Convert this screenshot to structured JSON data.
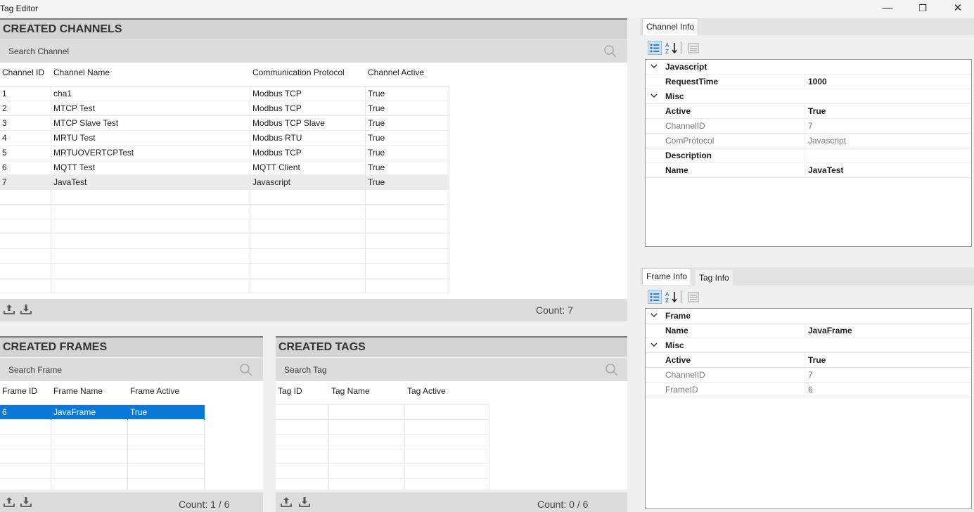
{
  "window": {
    "title": "Tag Editor",
    "minimize": "—",
    "restore": "❐",
    "close": "✕"
  },
  "channels": {
    "title": "CREATED CHANNELS",
    "search_placeholder": "Search Channel",
    "headers": [
      "Channel ID",
      "Channel Name",
      "Communication Protocol",
      "Channel Active"
    ],
    "rows": [
      [
        "1",
        "cha1",
        "Modbus TCP",
        "True"
      ],
      [
        "2",
        "MTCP Test",
        "Modbus TCP",
        "True"
      ],
      [
        "3",
        "MTCP Slave Test",
        "Modbus TCP Slave",
        "True"
      ],
      [
        "4",
        "MRTU Test",
        "Modbus RTU",
        "True"
      ],
      [
        "5",
        "MRTUOVERTCPTest",
        "Modbus TCP",
        "True"
      ],
      [
        "6",
        "MQTT Test",
        "MQTT Client",
        "True"
      ],
      [
        "7",
        "JavaTest",
        "Javascript",
        "True"
      ]
    ],
    "selected_index": 6,
    "count": "Count: 7"
  },
  "frames": {
    "title": "CREATED FRAMES",
    "search_placeholder": "Search Frame",
    "headers": [
      "Frame ID",
      "Frame Name",
      "Frame Active"
    ],
    "rows": [
      [
        "6",
        "JavaFrame",
        "True"
      ]
    ],
    "selected_index": 0,
    "count": "Count: 1 / 6"
  },
  "tags": {
    "title": "CREATED TAGS",
    "search_placeholder": "Search Tag",
    "headers": [
      "Tag ID",
      "Tag Name",
      "Tag Active"
    ],
    "rows": [],
    "count": "Count: 0 / 6"
  },
  "channel_info": {
    "tab": "Channel Info",
    "sort_label": "A↓Z",
    "categories": [
      {
        "name": "Javascript",
        "props": [
          {
            "name": "RequestTime",
            "value": "1000",
            "style": "bold"
          }
        ]
      },
      {
        "name": "Misc",
        "props": [
          {
            "name": "Active",
            "value": "True",
            "style": "bold"
          },
          {
            "name": "ChannelID",
            "value": "7",
            "style": "gray"
          },
          {
            "name": "ComProtocol",
            "value": "Javascript",
            "style": "gray"
          },
          {
            "name": "Description",
            "value": "",
            "style": "bold"
          },
          {
            "name": "Name",
            "value": "JavaTest",
            "style": "bold"
          }
        ]
      }
    ]
  },
  "frame_info": {
    "tabs": [
      "Frame Info",
      "Tag Info"
    ],
    "active_tab": 0,
    "categories": [
      {
        "name": "Frame",
        "props": [
          {
            "name": "Name",
            "value": "JavaFrame",
            "style": "bold"
          }
        ]
      },
      {
        "name": "Misc",
        "props": [
          {
            "name": "Active",
            "value": "True",
            "style": "bold"
          },
          {
            "name": "ChannelID",
            "value": "7",
            "style": "gray"
          },
          {
            "name": "FrameID",
            "value": "6",
            "style": "gray"
          }
        ]
      }
    ]
  },
  "colors": {
    "selection": "#0a78d7",
    "panel": "#dcdcdc"
  }
}
